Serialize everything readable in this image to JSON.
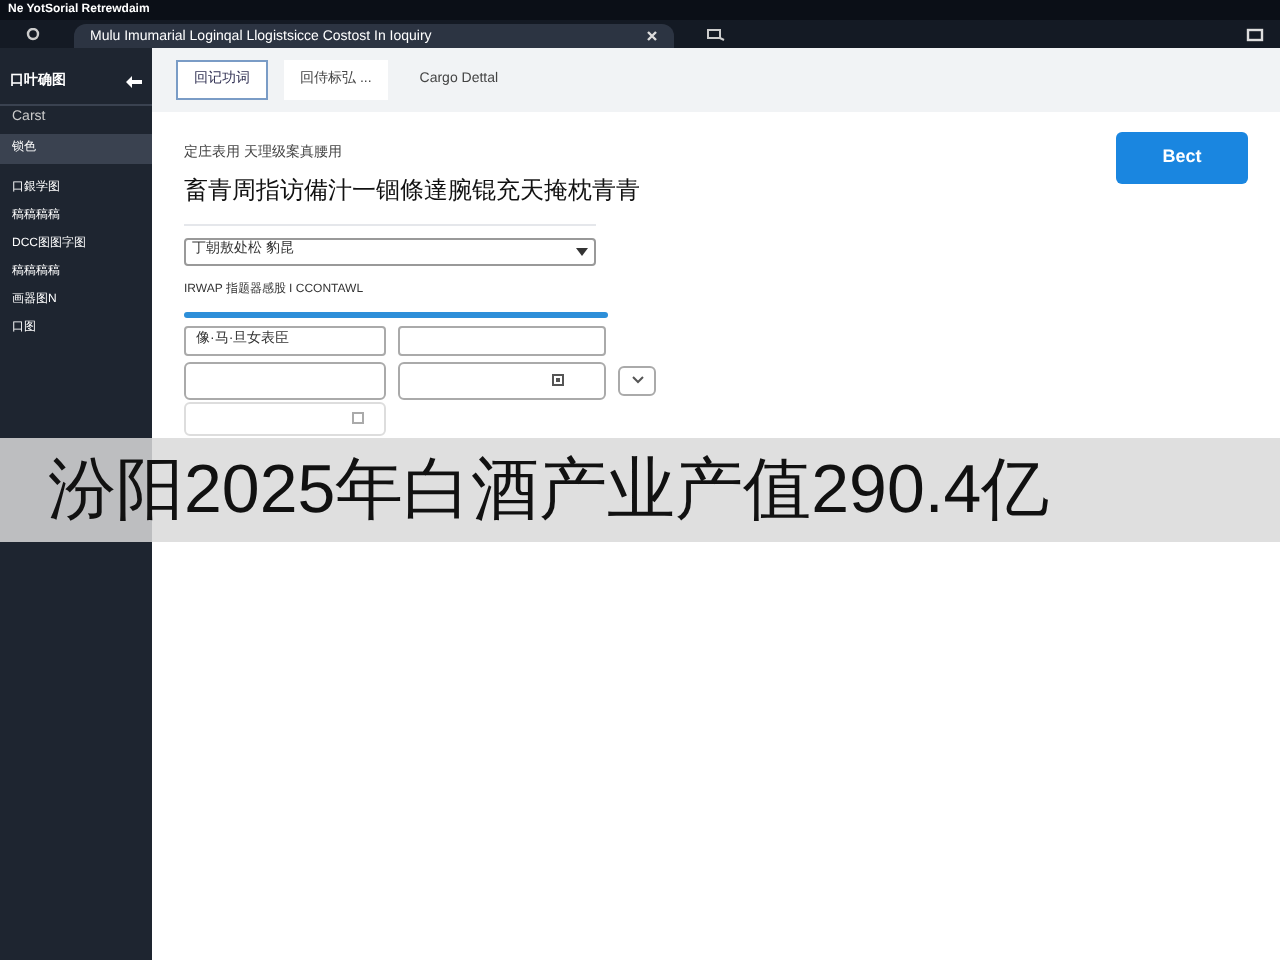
{
  "window": {
    "title": "Ne YotSorial Retrewdaim"
  },
  "tab": {
    "title": "Mulu Imumarial Loginqal Llogistsicce Costost In Ioquiry"
  },
  "sidebar": {
    "title": "口叶确图",
    "items": [
      {
        "label": "Carst",
        "selected": false,
        "kind": "header"
      },
      {
        "label": "锁色",
        "selected": true,
        "kind": "item"
      },
      {
        "label": "口銀学图",
        "selected": false,
        "kind": "item"
      },
      {
        "label": "稿稿稿稿",
        "selected": false,
        "kind": "item"
      },
      {
        "label": "DCC图图字图",
        "selected": false,
        "kind": "item"
      },
      {
        "label": "稿稿稿稿",
        "selected": false,
        "kind": "item"
      },
      {
        "label": "画器图N",
        "selected": false,
        "kind": "item"
      },
      {
        "label": "口图",
        "selected": false,
        "kind": "item"
      }
    ]
  },
  "toolbar": {
    "tabs": [
      {
        "label": "回记功词",
        "selected": true
      },
      {
        "label": "回侍标弘 ...",
        "selected": false
      },
      {
        "label": "Cargo Dettal",
        "selected": false
      }
    ]
  },
  "form": {
    "breadcrumb": "定庄表用 天理级案真腰用",
    "heading": "畜青周指访備汁一锢條達腕锟充天掩枕青青",
    "select_value": "丁朝敖处松 豹昆",
    "note": "IRWAP 指题器感股 I CCONTAWL",
    "field_1": "像·马·旦女表臣",
    "action_button": "Bect"
  },
  "caption": "汾阳2025年白酒产业产值290.4亿"
}
